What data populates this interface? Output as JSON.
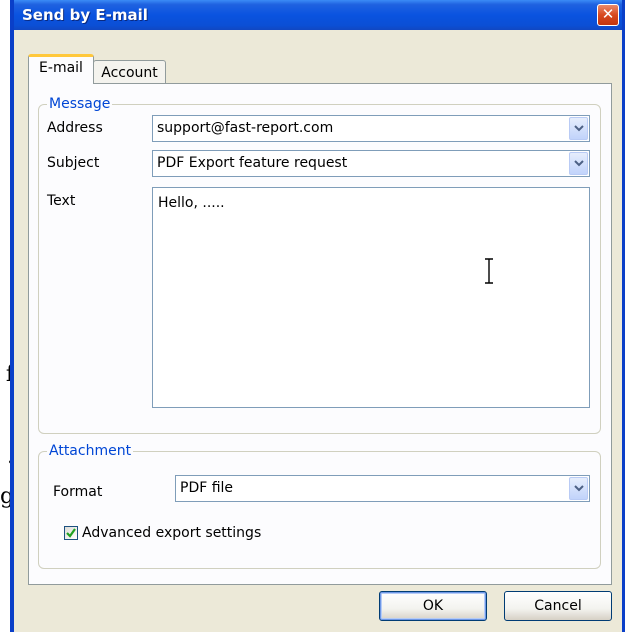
{
  "background": {
    "fragments": [
      "f",
      ".",
      "g"
    ]
  },
  "window": {
    "title": "Send by E-mail",
    "close_glyph": "✕"
  },
  "tabs": [
    {
      "label": "E-mail",
      "active": true
    },
    {
      "label": "Account",
      "active": false
    }
  ],
  "message": {
    "legend": "Message",
    "address_label": "Address",
    "address_value": "support@fast-report.com",
    "subject_label": "Subject",
    "subject_value": "PDF Export feature request",
    "text_label": "Text",
    "text_value": "Hello, ....."
  },
  "attachment": {
    "legend": "Attachment",
    "format_label": "Format",
    "format_value": "PDF file",
    "advanced_label": "Advanced export settings",
    "advanced_checked": true
  },
  "buttons": {
    "ok": "OK",
    "cancel": "Cancel"
  },
  "colors": {
    "title_bar": "#0a53e0",
    "legend_text": "#0046d5",
    "dialog_face": "#ece9d8",
    "close_button": "#d8491f"
  },
  "icons": {
    "close": "close-icon",
    "dropdown": "chevron-down-icon",
    "checkmark": "checkmark-icon",
    "cursor": "text-cursor-icon"
  }
}
